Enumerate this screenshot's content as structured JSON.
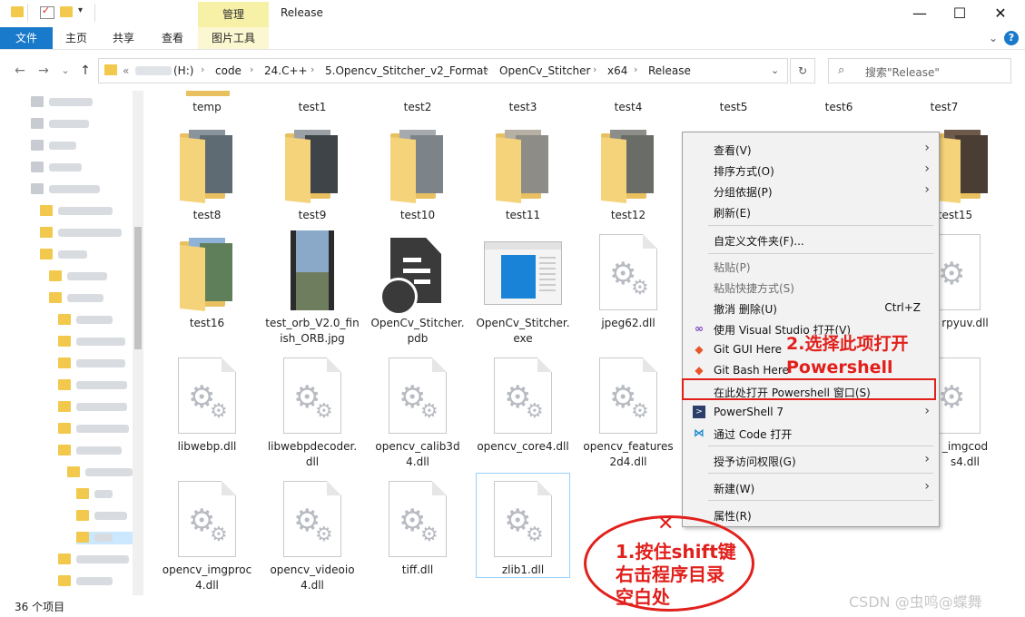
{
  "window": {
    "title": "Release",
    "ribbon_context_tab": "管理",
    "controls": {
      "minimize": "—",
      "maximize": "☐",
      "close": "✕"
    }
  },
  "ribbon": {
    "tabs": [
      "文件",
      "主页",
      "共享",
      "查看",
      "图片工具"
    ],
    "expand": "⌄",
    "help": "?"
  },
  "nav": {
    "back": "←",
    "forward": "→",
    "recent": "⌄",
    "up": "↑",
    "refresh": "↻"
  },
  "address": {
    "overflow": "«",
    "crumbs": [
      "(H:)",
      "code",
      "24.C++",
      "5.Opencv_Stitcher_v2_Format",
      "OpenCv_Stitcher",
      "x64",
      "Release"
    ],
    "separator": "›",
    "dropdown": "⌄"
  },
  "search": {
    "placeholder": "搜索\"Release\""
  },
  "files": {
    "row0": [
      "temp",
      "test1",
      "test2",
      "test3",
      "test4",
      "test5",
      "test6",
      "test7"
    ],
    "row1": [
      "test8",
      "test9",
      "test10",
      "test11",
      "test12",
      "test15"
    ],
    "row2": [
      "test16",
      "test_orb_V2.0_finish_ORB.jpg",
      "OpenCv_Stitcher.pdb",
      "OpenCv_Stitcher.exe",
      "jpeg62.dll",
      "rpyuv.dll"
    ],
    "row3": [
      "libwebp.dll",
      "libwebpdecoder.dll",
      "opencv_calib3d4.dll",
      "opencv_core4.dll",
      "opencv_features2d4.dll",
      "_imgcods4.dll"
    ],
    "row4": [
      "opencv_imgproc4.dll",
      "opencv_videoio4.dll",
      "tiff.dll",
      "zlib1.dll"
    ]
  },
  "context_menu": {
    "items": [
      {
        "label": "查看(V)",
        "submenu": true
      },
      {
        "label": "排序方式(O)",
        "submenu": true
      },
      {
        "label": "分组依据(P)",
        "submenu": true
      },
      {
        "label": "刷新(E)"
      },
      {
        "label": "自定义文件夹(F)..."
      },
      {
        "label": "粘贴(P)",
        "disabled": true
      },
      {
        "label": "粘贴快捷方式(S)",
        "disabled": true
      },
      {
        "label": "撤消 删除(U)",
        "shortcut": "Ctrl+Z"
      },
      {
        "label": "使用 Visual Studio 打开(V)",
        "icon": "visual-studio-icon"
      },
      {
        "label": "Git GUI Here",
        "icon": "git-icon"
      },
      {
        "label": "Git Bash Here",
        "icon": "git-icon"
      },
      {
        "label": "在此处打开 Powershell 窗口(S)"
      },
      {
        "label": "PowerShell 7",
        "icon": "powershell-icon",
        "submenu": true
      },
      {
        "label": "通过 Code 打开",
        "icon": "vscode-icon"
      },
      {
        "label": "授予访问权限(G)",
        "submenu": true
      },
      {
        "label": "新建(W)",
        "submenu": true
      },
      {
        "label": "属性(R)"
      }
    ],
    "submenu_arrow": "›"
  },
  "annotations": {
    "step2": "2.选择此项打开",
    "step2_b": "Powershell",
    "step1_lines": [
      "1.按住shift键",
      "右击程序目录",
      "空白处"
    ],
    "cross": "✕",
    "color": "#e1201c"
  },
  "status": {
    "item_count": "36 个项目"
  },
  "watermark": "CSDN @虫鸣@蝶舞",
  "colors": {
    "file_tab": "#1979ca",
    "selection_border": "#99d1ff",
    "menu_bg": "#f2f2f2"
  }
}
